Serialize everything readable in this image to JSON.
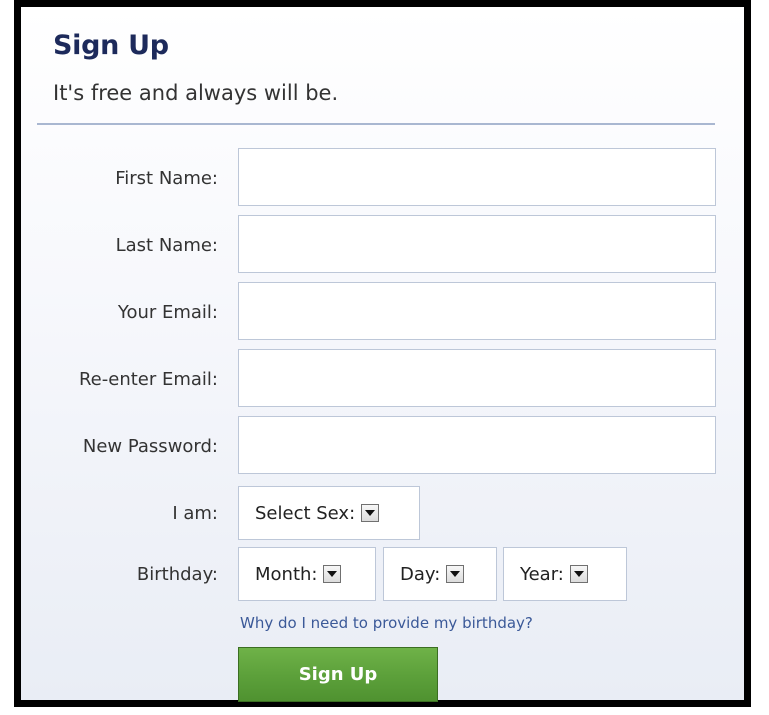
{
  "header": {
    "title": "Sign Up",
    "subtitle": "It's free and always will be."
  },
  "form": {
    "first_name": {
      "label": "First Name:",
      "value": ""
    },
    "last_name": {
      "label": "Last Name:",
      "value": ""
    },
    "email": {
      "label": "Your Email:",
      "value": ""
    },
    "email_confirm": {
      "label": "Re-enter Email:",
      "value": ""
    },
    "password": {
      "label": "New Password:",
      "value": ""
    },
    "sex": {
      "label": "I am:",
      "selected": "Select Sex:"
    },
    "birthday": {
      "label": "Birthday:",
      "month": "Month:",
      "day": "Day:",
      "year": "Year:"
    },
    "birthday_help": "Why do I need to provide my birthday?",
    "submit_label": "Sign Up"
  },
  "colors": {
    "title": "#1d2a5b",
    "link": "#3b5998",
    "button": "#5da13b",
    "field_border": "#bdc7d8"
  },
  "icons": {
    "dropdown": "chevron-down-icon"
  }
}
